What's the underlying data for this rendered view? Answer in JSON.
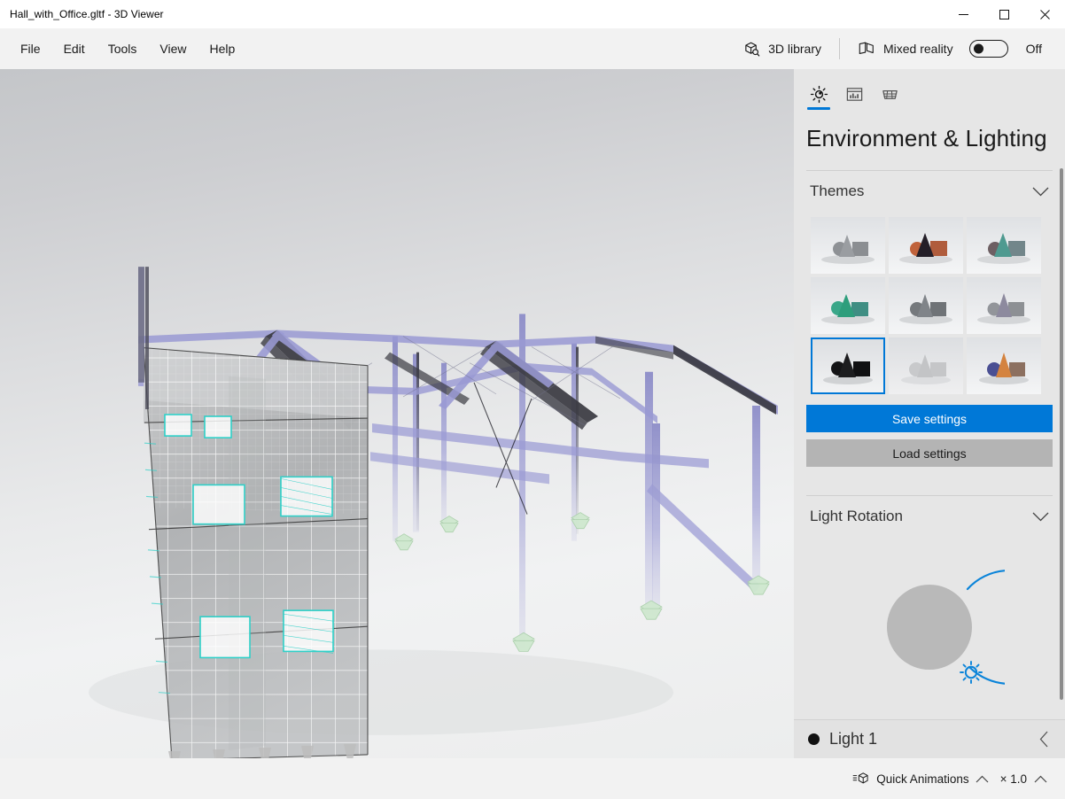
{
  "window": {
    "title": "Hall_with_Office.gltf - 3D Viewer",
    "minimize_label": "—",
    "maximize_label": "□",
    "close_label": "✕"
  },
  "menu": {
    "items": [
      {
        "label": "File"
      },
      {
        "label": "Edit"
      },
      {
        "label": "Tools"
      },
      {
        "label": "View"
      },
      {
        "label": "Help"
      }
    ],
    "library_button": {
      "label": "3D library",
      "icon": "cube-search-icon"
    },
    "mixed_reality": {
      "label": "Mixed reality",
      "icon": "mixed-reality-icon",
      "toggle_state": "Off"
    }
  },
  "panel": {
    "tabs": [
      {
        "icon": "sun-icon",
        "name": "environment-lighting",
        "active": true
      },
      {
        "icon": "statistics-icon",
        "name": "statistics",
        "active": false
      },
      {
        "icon": "grid-icon",
        "name": "grid",
        "active": false
      }
    ],
    "title": "Environment & Lighting",
    "sections": {
      "themes": {
        "label": "Themes",
        "expander_icon": "chevron-down-icon",
        "selected_index": 6,
        "items": [
          {
            "name": "theme-neutral-gray",
            "bg_top": "#dfe1e4",
            "bg_bottom": "#f4f5f6",
            "cone": "#9a9da1",
            "sphere": "#8e9195",
            "cube": "#8b8e92"
          },
          {
            "name": "theme-warm-sunset",
            "bg_top": "#dfe1e4",
            "bg_bottom": "#f4f5f6",
            "cone": "#241f28",
            "sphere": "#c0623b",
            "cube": "#b05c3c"
          },
          {
            "name": "theme-teal-cool",
            "bg_top": "#d7dadd",
            "bg_bottom": "#f2f3f4",
            "cone": "#4f9a90",
            "sphere": "#6d5f63",
            "cube": "#72868a"
          },
          {
            "name": "theme-emerald",
            "bg_top": "#dfe1e4",
            "bg_bottom": "#f4f5f6",
            "cone": "#2e9e7c",
            "sphere": "#3aa789",
            "cube": "#3f8e83"
          },
          {
            "name": "theme-studio-gray",
            "bg_top": "#dfe1e4",
            "bg_bottom": "#f4f5f6",
            "cone": "#808489",
            "sphere": "#75797d",
            "cube": "#6f7377"
          },
          {
            "name": "theme-cool-violet",
            "bg_top": "#dfe1e4",
            "bg_bottom": "#f4f5f6",
            "cone": "#8d8a9e",
            "sphere": "#92959a",
            "cube": "#8d9094"
          },
          {
            "name": "theme-dark-contrast",
            "bg_top": "#dcdee1",
            "bg_bottom": "#f2f3f4",
            "cone": "#1d1d1f",
            "sphere": "#141416",
            "cube": "#101012"
          },
          {
            "name": "theme-soft-light",
            "bg_top": "#dcdee1",
            "bg_bottom": "#efeff0",
            "cone": "#c3c4c6",
            "sphere": "#c8c9cb",
            "cube": "#c5c6c8"
          },
          {
            "name": "theme-colorful",
            "bg_top": "#d9dbdf",
            "bg_bottom": "#f2f3f4",
            "cone": "#d4833f",
            "sphere": "#4a4f93",
            "cube": "#8c7060"
          }
        ]
      },
      "save_button": {
        "label": "Save settings",
        "color": "#0078d7"
      },
      "load_button": {
        "label": "Load settings",
        "color": "#b4b4b4"
      },
      "light_rotation": {
        "label": "Light Rotation",
        "expander_icon": "chevron-down-icon",
        "dial": {
          "track_color": "#0b84d9",
          "knob_color": "#b9b9b9",
          "handle_icon": "sun-handle-icon"
        }
      }
    },
    "light_row": {
      "label": "Light 1",
      "bullet_icon": "filled-circle-icon",
      "collapse_icon": "chevron-left-icon"
    }
  },
  "statusbar": {
    "quick_animations": {
      "label": "Quick Animations",
      "icon": "animation-cube-icon",
      "expander_icon": "chevron-up-icon"
    },
    "speed": {
      "label": "× 1.0",
      "expander_icon": "chevron-up-icon"
    }
  },
  "viewport": {
    "model_name": "Hall_with_Office",
    "colors": {
      "beam_purple": "#9a9ad4",
      "beam_dark": "#3a3a42",
      "mesh_line": "#ffffff",
      "window_outline": "#2fd0c8",
      "support_green": "#cfe8cf"
    }
  }
}
